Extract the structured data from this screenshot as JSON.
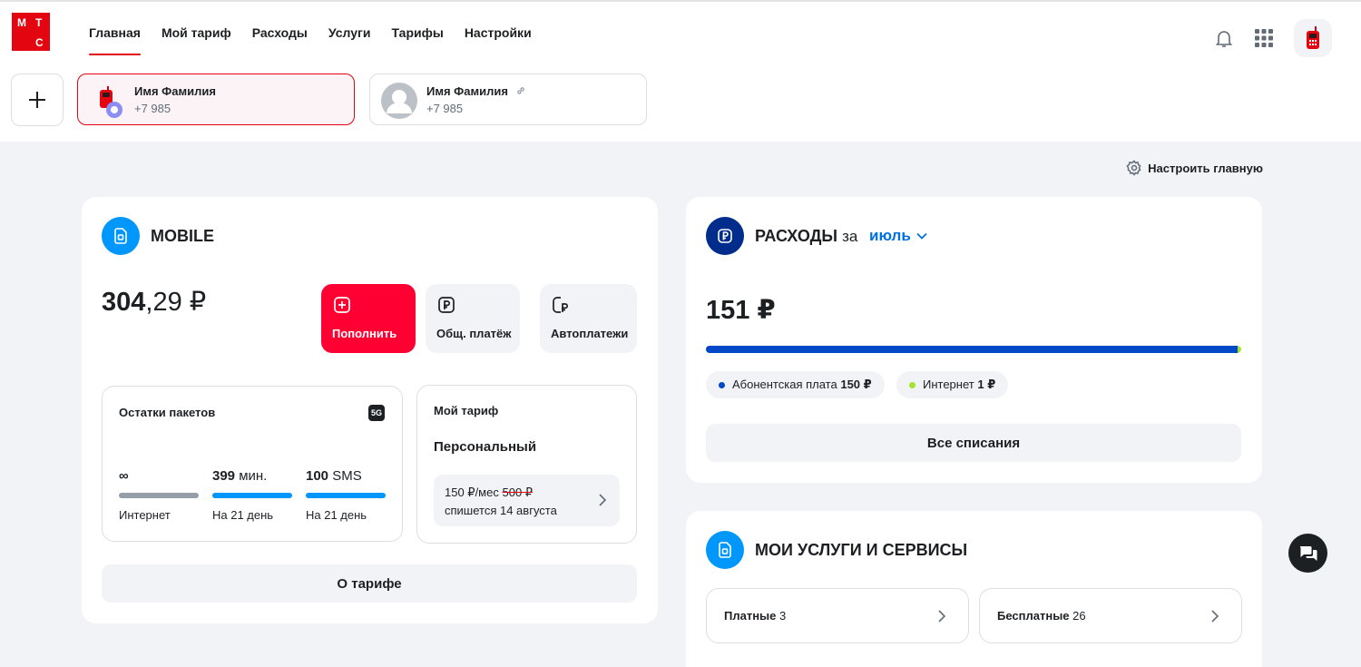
{
  "brand": {
    "logo_letters": [
      "М",
      "Т",
      "С"
    ],
    "accent": "#e30611",
    "primary_button": "#ff0032"
  },
  "nav": {
    "items": [
      {
        "label": "Главная",
        "active": true
      },
      {
        "label": "Мой тариф",
        "active": false
      },
      {
        "label": "Расходы",
        "active": false
      },
      {
        "label": "Услуги",
        "active": false
      },
      {
        "label": "Тарифы",
        "active": false
      },
      {
        "label": "Настройки",
        "active": false
      }
    ],
    "icons": [
      "bell-icon",
      "apps-grid-icon",
      "phone-avatar-icon"
    ]
  },
  "accounts": [
    {
      "name": "Имя Фамилия",
      "phone": "+7 985",
      "active": true,
      "avatar": "red-phone-icon"
    },
    {
      "name": "Имя Фамилия",
      "phone": "+7 985",
      "active": false,
      "avatar": "person-placeholder-icon",
      "linked": true
    }
  ],
  "customize_label": "Настроить главную",
  "mobile": {
    "title": "MOBILE",
    "balance_int": "304",
    "balance_frac": ",29 ₽",
    "actions": [
      {
        "label": "Пополнить",
        "icon": "plus-square-icon"
      },
      {
        "label": "Общ. платёж",
        "icon": "ruble-square-icon"
      },
      {
        "label": "Автоплатежи",
        "icon": "autopay-icon"
      }
    ],
    "packages": {
      "title": "Остатки пакетов",
      "badge": "5G",
      "items": [
        {
          "value": "∞",
          "unit": "",
          "caption": "Интернет",
          "fill": 1.0,
          "color": "#969fa8"
        },
        {
          "value": "399",
          "unit": " мин.",
          "caption": "На 21 день",
          "fill": 1.0,
          "color": "#0097fd"
        },
        {
          "value": "100",
          "unit": " SMS",
          "caption": "На 21 день",
          "fill": 1.0,
          "color": "#0097fd"
        }
      ]
    },
    "tariff": {
      "title": "Мой тариф",
      "name": "Персональный",
      "price": "150 ₽/мес",
      "old_price": "500 ₽",
      "charge_note": "спишется 14 августа"
    },
    "about_button": "О тарифе"
  },
  "expenses": {
    "title": "РАСХОДЫ",
    "period_prefix": "за",
    "period": "июль",
    "total": "151 ₽",
    "segments": [
      {
        "label": "Абонентская плата",
        "amount": "150 ₽",
        "share": 0.993,
        "color": "#0048c7"
      },
      {
        "label": "Интернет",
        "amount": "1 ₽",
        "share": 0.007,
        "color": "#a5e22a"
      }
    ],
    "all_button": "Все списания"
  },
  "services": {
    "title": "МОИ УСЛУГИ И СЕРВИСЫ",
    "items": [
      {
        "label": "Платные",
        "count": "3"
      },
      {
        "label": "Бесплатные",
        "count": "26"
      }
    ]
  }
}
